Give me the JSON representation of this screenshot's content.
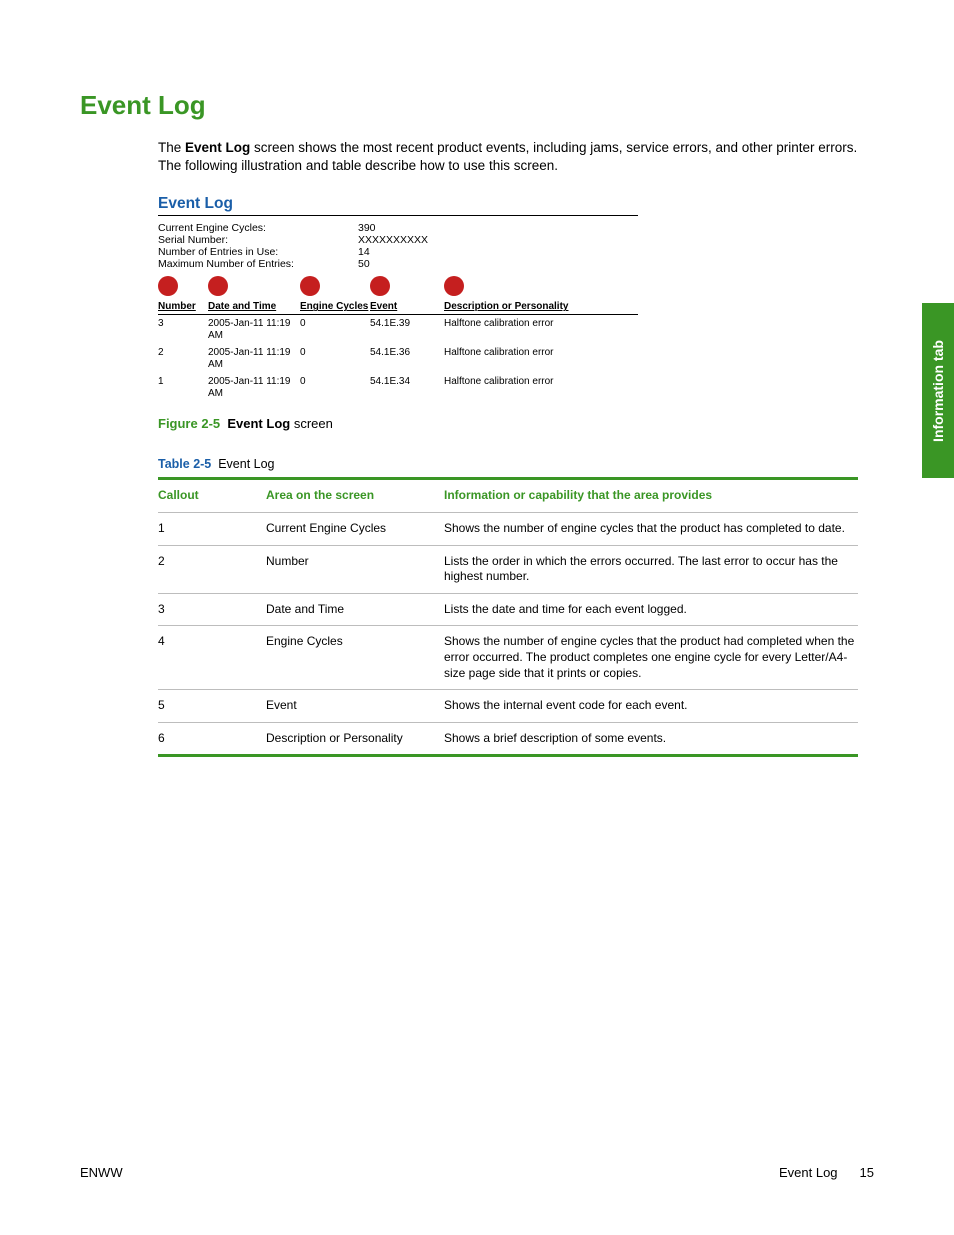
{
  "title": "Event Log",
  "intro_prefix": "The ",
  "intro_bold": "Event Log",
  "intro_suffix": " screen shows the most recent product events, including jams, service errors, and other printer errors. The following illustration and table describe how to use this screen.",
  "figure": {
    "heading": "Event Log",
    "stats": [
      {
        "label": "Current Engine Cycles:",
        "value": "390"
      },
      {
        "label": "Serial Number:",
        "value": "XXXXXXXXXX"
      },
      {
        "label": "Number of Entries in Use:",
        "value": "14"
      },
      {
        "label": "Maximum Number of Entries:",
        "value": "50"
      }
    ],
    "columns": {
      "number": "Number",
      "date": "Date and Time",
      "engine": "Engine Cycles",
      "event": "Event",
      "desc": "Description or Personality"
    },
    "rows": [
      {
        "number": "3",
        "date": "2005-Jan-11 11:19 AM",
        "engine": "0",
        "event": "54.1E.39",
        "desc": "Halftone calibration error"
      },
      {
        "number": "2",
        "date": "2005-Jan-11 11:19 AM",
        "engine": "0",
        "event": "54.1E.36",
        "desc": "Halftone calibration error"
      },
      {
        "number": "1",
        "date": "2005-Jan-11 11:19 AM",
        "engine": "0",
        "event": "54.1E.34",
        "desc": "Halftone calibration error"
      }
    ]
  },
  "figure_caption": {
    "num": "Figure 2-5",
    "title": "Event Log",
    "suffix": " screen"
  },
  "table_caption": {
    "num": "Table 2-5",
    "title": "Event Log"
  },
  "ref_table": {
    "headers": {
      "callout": "Callout",
      "area": "Area on the screen",
      "info": "Information or capability that the area provides"
    },
    "rows": [
      {
        "callout": "1",
        "area": "Current Engine Cycles",
        "info": "Shows the number of engine cycles that the product has completed to date."
      },
      {
        "callout": "2",
        "area": "Number",
        "info": "Lists the order in which the errors occurred. The last error to occur has the highest number."
      },
      {
        "callout": "3",
        "area": "Date and Time",
        "info": "Lists the date and time for each event logged."
      },
      {
        "callout": "4",
        "area": "Engine Cycles",
        "info": "Shows the number of engine cycles that the product had completed when the error occurred. The product completes one engine cycle for every Letter/A4-size page side that it prints or copies."
      },
      {
        "callout": "5",
        "area": "Event",
        "info": "Shows the internal event code for each event."
      },
      {
        "callout": "6",
        "area": "Description or Personality",
        "info": "Shows a brief description of some events."
      }
    ]
  },
  "side_tab": "Information tab",
  "footer": {
    "left": "ENWW",
    "section": "Event Log",
    "page": "15"
  }
}
